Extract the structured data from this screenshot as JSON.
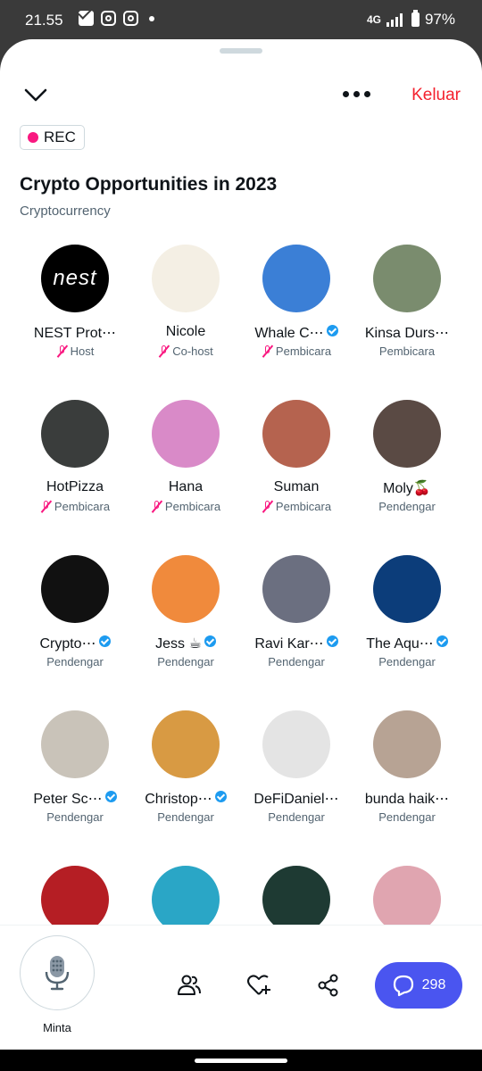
{
  "status_bar": {
    "time": "21.55",
    "network": "4G",
    "battery": "97%"
  },
  "header": {
    "logout_label": "Keluar"
  },
  "rec_badge": "REC",
  "space": {
    "title": "Crypto Opportunities in 2023",
    "topic": "Cryptocurrency"
  },
  "participants": [
    {
      "name": "NEST Prot⋯",
      "role": "Host",
      "muted": true,
      "verified": false,
      "avatar_bg": "#000000",
      "avatar_text": "nest"
    },
    {
      "name": "Nicole",
      "role": "Co-host",
      "muted": true,
      "verified": false,
      "avatar_bg": "#f4efe4",
      "avatar_text": ""
    },
    {
      "name": "Whale C⋯",
      "role": "Pembicara",
      "muted": true,
      "verified": true,
      "avatar_bg": "#3b7fd6",
      "avatar_text": ""
    },
    {
      "name": "Kinsa Durs⋯",
      "role": "Pembicara",
      "muted": false,
      "verified": false,
      "avatar_bg": "#7a8c6e",
      "avatar_text": ""
    },
    {
      "name": "HotPizza",
      "role": "Pembicara",
      "muted": true,
      "verified": false,
      "avatar_bg": "#3a3d3c",
      "avatar_text": ""
    },
    {
      "name": "Hana",
      "role": "Pembicara",
      "muted": true,
      "verified": false,
      "avatar_bg": "#d98ac8",
      "avatar_text": ""
    },
    {
      "name": "Suman",
      "role": "Pembicara",
      "muted": true,
      "verified": false,
      "avatar_bg": "#b5634f",
      "avatar_text": ""
    },
    {
      "name": "Moly🍒",
      "role": "Pendengar",
      "muted": false,
      "verified": false,
      "avatar_bg": "#5a4a44",
      "avatar_text": ""
    },
    {
      "name": "Crypto⋯",
      "role": "Pendengar",
      "muted": false,
      "verified": true,
      "avatar_bg": "#111111",
      "avatar_text": ""
    },
    {
      "name": "Jess ☕",
      "role": "Pendengar",
      "muted": false,
      "verified": true,
      "avatar_bg": "#f08a3c",
      "avatar_text": ""
    },
    {
      "name": "Ravi Kar⋯",
      "role": "Pendengar",
      "muted": false,
      "verified": true,
      "avatar_bg": "#6b6f80",
      "avatar_text": ""
    },
    {
      "name": "The Aqu⋯",
      "role": "Pendengar",
      "muted": false,
      "verified": true,
      "avatar_bg": "#0c3d7a",
      "avatar_text": ""
    },
    {
      "name": "Peter Sc⋯",
      "role": "Pendengar",
      "muted": false,
      "verified": true,
      "avatar_bg": "#c9c3b9",
      "avatar_text": ""
    },
    {
      "name": "Christop⋯",
      "role": "Pendengar",
      "muted": false,
      "verified": true,
      "avatar_bg": "#d89a43",
      "avatar_text": ""
    },
    {
      "name": "DeFiDaniel⋯",
      "role": "Pendengar",
      "muted": false,
      "verified": false,
      "avatar_bg": "#e4e4e4",
      "avatar_text": ""
    },
    {
      "name": "bunda haik⋯",
      "role": "Pendengar",
      "muted": false,
      "verified": false,
      "avatar_bg": "#b7a394",
      "avatar_text": ""
    },
    {
      "name": "",
      "role": "",
      "muted": false,
      "verified": false,
      "avatar_bg": "#b51e24",
      "avatar_text": ""
    },
    {
      "name": "",
      "role": "",
      "muted": false,
      "verified": false,
      "avatar_bg": "#2aa6c6",
      "avatar_text": ""
    },
    {
      "name": "",
      "role": "",
      "muted": false,
      "verified": false,
      "avatar_bg": "#1e3a33",
      "avatar_text": ""
    },
    {
      "name": "",
      "role": "",
      "muted": false,
      "verified": false,
      "avatar_bg": "#e0a5b0",
      "avatar_text": ""
    }
  ],
  "bottom_bar": {
    "request_label": "Minta",
    "comment_count": "298"
  },
  "colors": {
    "accent_pink": "#f91880",
    "verified_blue": "#1d9bf0",
    "comment_button": "#4a55f0",
    "logout_red": "#f4212e"
  },
  "icons": [
    "chevron-down-icon",
    "more-icon",
    "mic-off-icon",
    "mic-icon",
    "people-icon",
    "heart-plus-icon",
    "share-icon",
    "comment-icon",
    "verified-icon"
  ]
}
